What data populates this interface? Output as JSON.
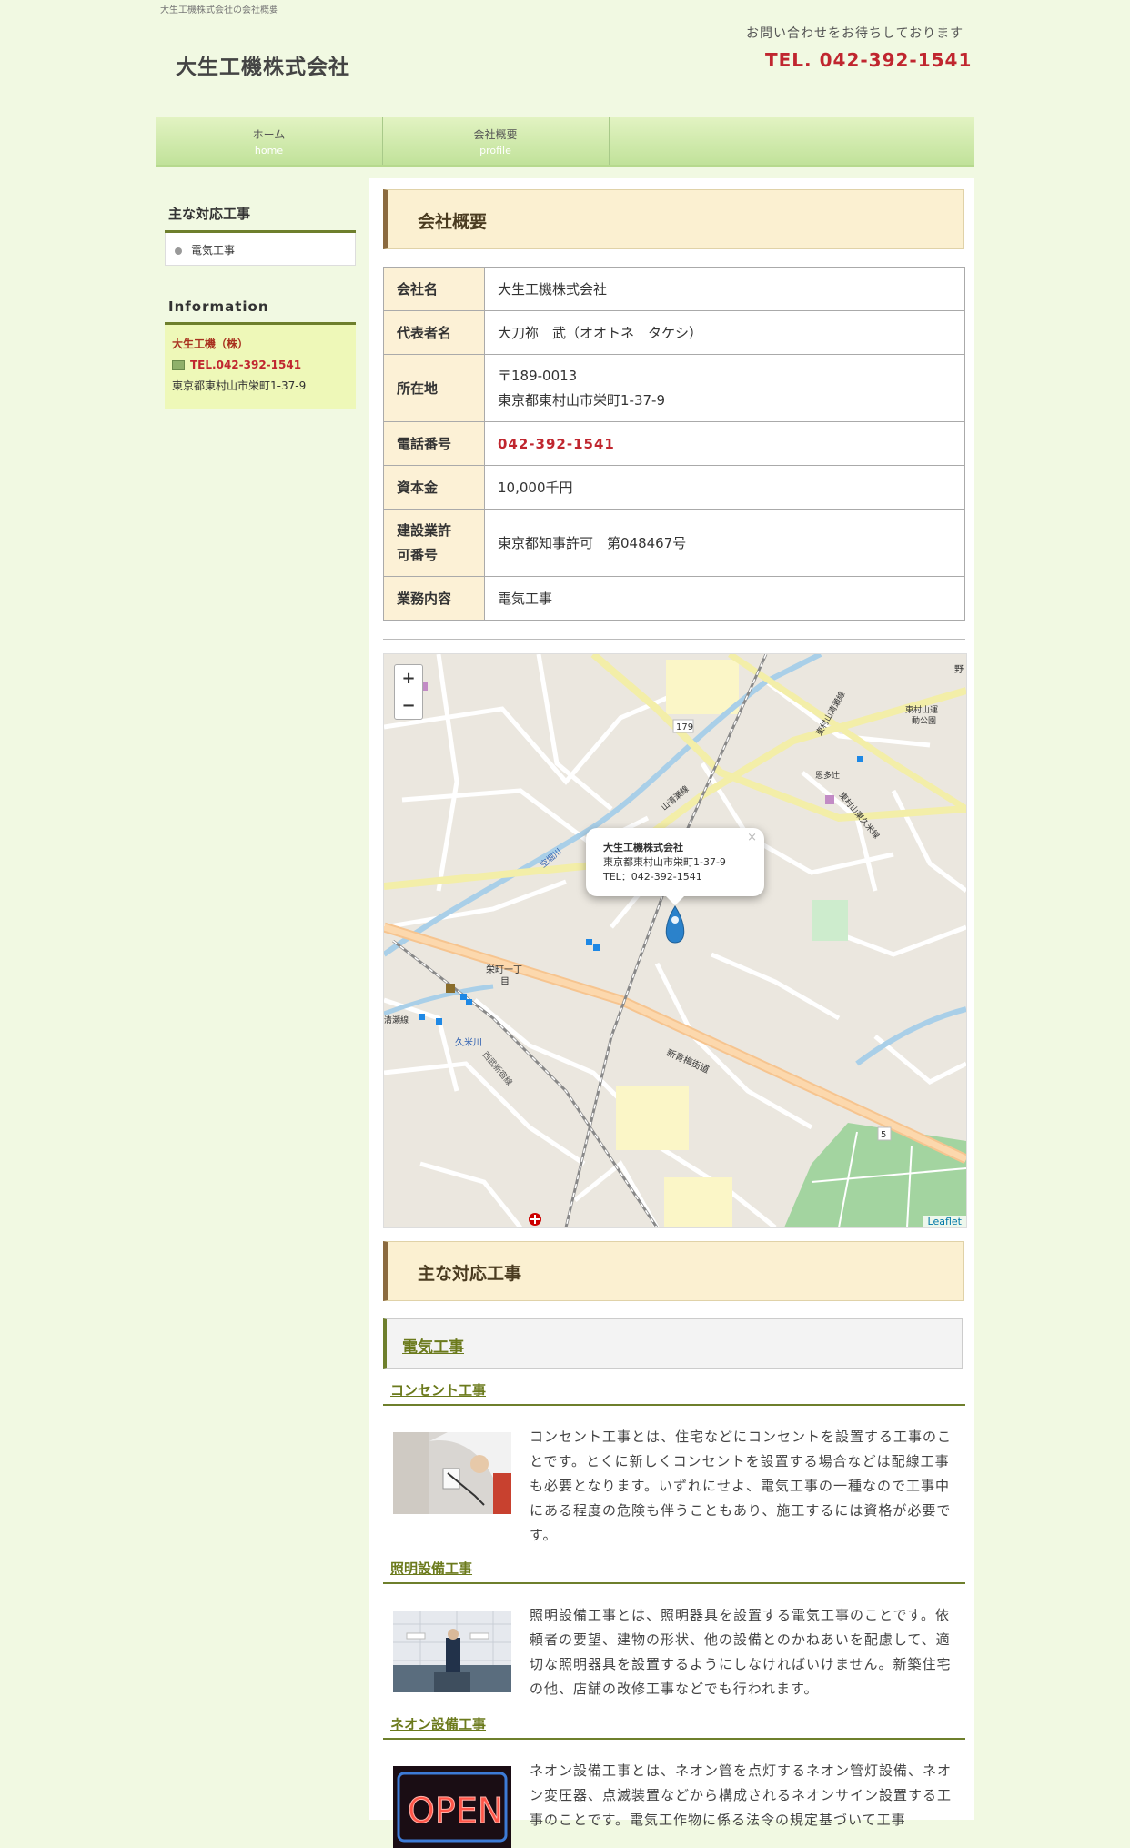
{
  "header": {
    "tagline": "大生工機株式会社の会社概要",
    "site_title": "大生工機株式会社",
    "contact_message": "お問い合わせをお待ちしております",
    "contact_tel": "TEL. 042-392-1541"
  },
  "nav": {
    "items": [
      {
        "label": "ホーム",
        "sub": "home"
      },
      {
        "label": "会社概要",
        "sub": "profile"
      }
    ]
  },
  "sidebar": {
    "services_heading": "主な対応工事",
    "services": [
      "電気工事"
    ],
    "info_heading": "Information",
    "company": "大生工機（株）",
    "tel": "TEL.042-392-1541",
    "address": "東京都東村山市栄町1-37-9"
  },
  "main": {
    "profile_heading": "会社概要",
    "profile_rows": [
      {
        "label": "会社名",
        "value": "大生工機株式会社"
      },
      {
        "label": "代表者名",
        "value": "大刀祢　武（オオトネ　タケシ）"
      },
      {
        "label": "所在地",
        "value": "〒189-0013",
        "value2": "東京都東村山市栄町1-37-9"
      },
      {
        "label": "電話番号",
        "value": "042-392-1541"
      },
      {
        "label": "資本金",
        "value": "10,000千円"
      },
      {
        "label": "建設業許",
        "label2": "可番号",
        "value": "東京都知事許可　第048467号"
      },
      {
        "label": "業務内容",
        "value": "電気工事"
      }
    ],
    "map": {
      "zoom_in": "+",
      "zoom_out": "−",
      "popup_title": "大生工機株式会社",
      "popup_address": "東京都東村山市栄町1-37-9",
      "popup_tel": "TEL：042-392-1541",
      "popup_close": "×",
      "attribution": "Leaflet",
      "labels": {
        "route179": "179",
        "route5": "5",
        "park": "東村山運",
        "park2": "動公園",
        "sakaemachi": "栄町一丁",
        "sakaemachi2": "目",
        "kumegawa": "久米川",
        "shinome": "新青梅街道",
        "seibu": "西武新宿線",
        "higashimurayama": "東村山清瀬線",
        "kiyose": "清瀬線",
        "kiyose2": "山清瀬線",
        "kume": "東村山東久米線",
        "onta": "恩多辻",
        "river": "空堀川",
        "no": "野"
      }
    },
    "services_heading": "主な対応工事",
    "category": "電気工事",
    "items": [
      {
        "title": "コンセント工事",
        "text": "コンセント工事とは、住宅などにコンセントを設置する工事のことです。とくに新しくコンセントを設置する場合などは配線工事も必要となります。いずれにせよ、電気工事の一種なので工事中にある程度の危険も伴うこともあり、施工するには資格が必要です。"
      },
      {
        "title": "照明設備工事",
        "text": "照明設備工事とは、照明器具を設置する電気工事のことです。依頼者の要望、建物の形状、他の設備とのかねあいを配慮して、適切な照明器具を設置するようにしなければいけません。新築住宅の他、店舗の改修工事などでも行われます。"
      },
      {
        "title": "ネオン設備工事",
        "text": "ネオン設備工事とは、ネオン管を点灯するネオン管灯設備、ネオン変圧器、点滅装置などから構成されるネオンサイン設置する工事のことです。電気工作物に係る法令の規定基づいて工事"
      },
      {
        "sign_text": "OPEN"
      }
    ]
  },
  "colors": {
    "page_bg": "#f1f9e2",
    "accent_red": "#c0262f",
    "heading_brown": "#8b6a3e",
    "accent_green": "#6e7f2c"
  }
}
